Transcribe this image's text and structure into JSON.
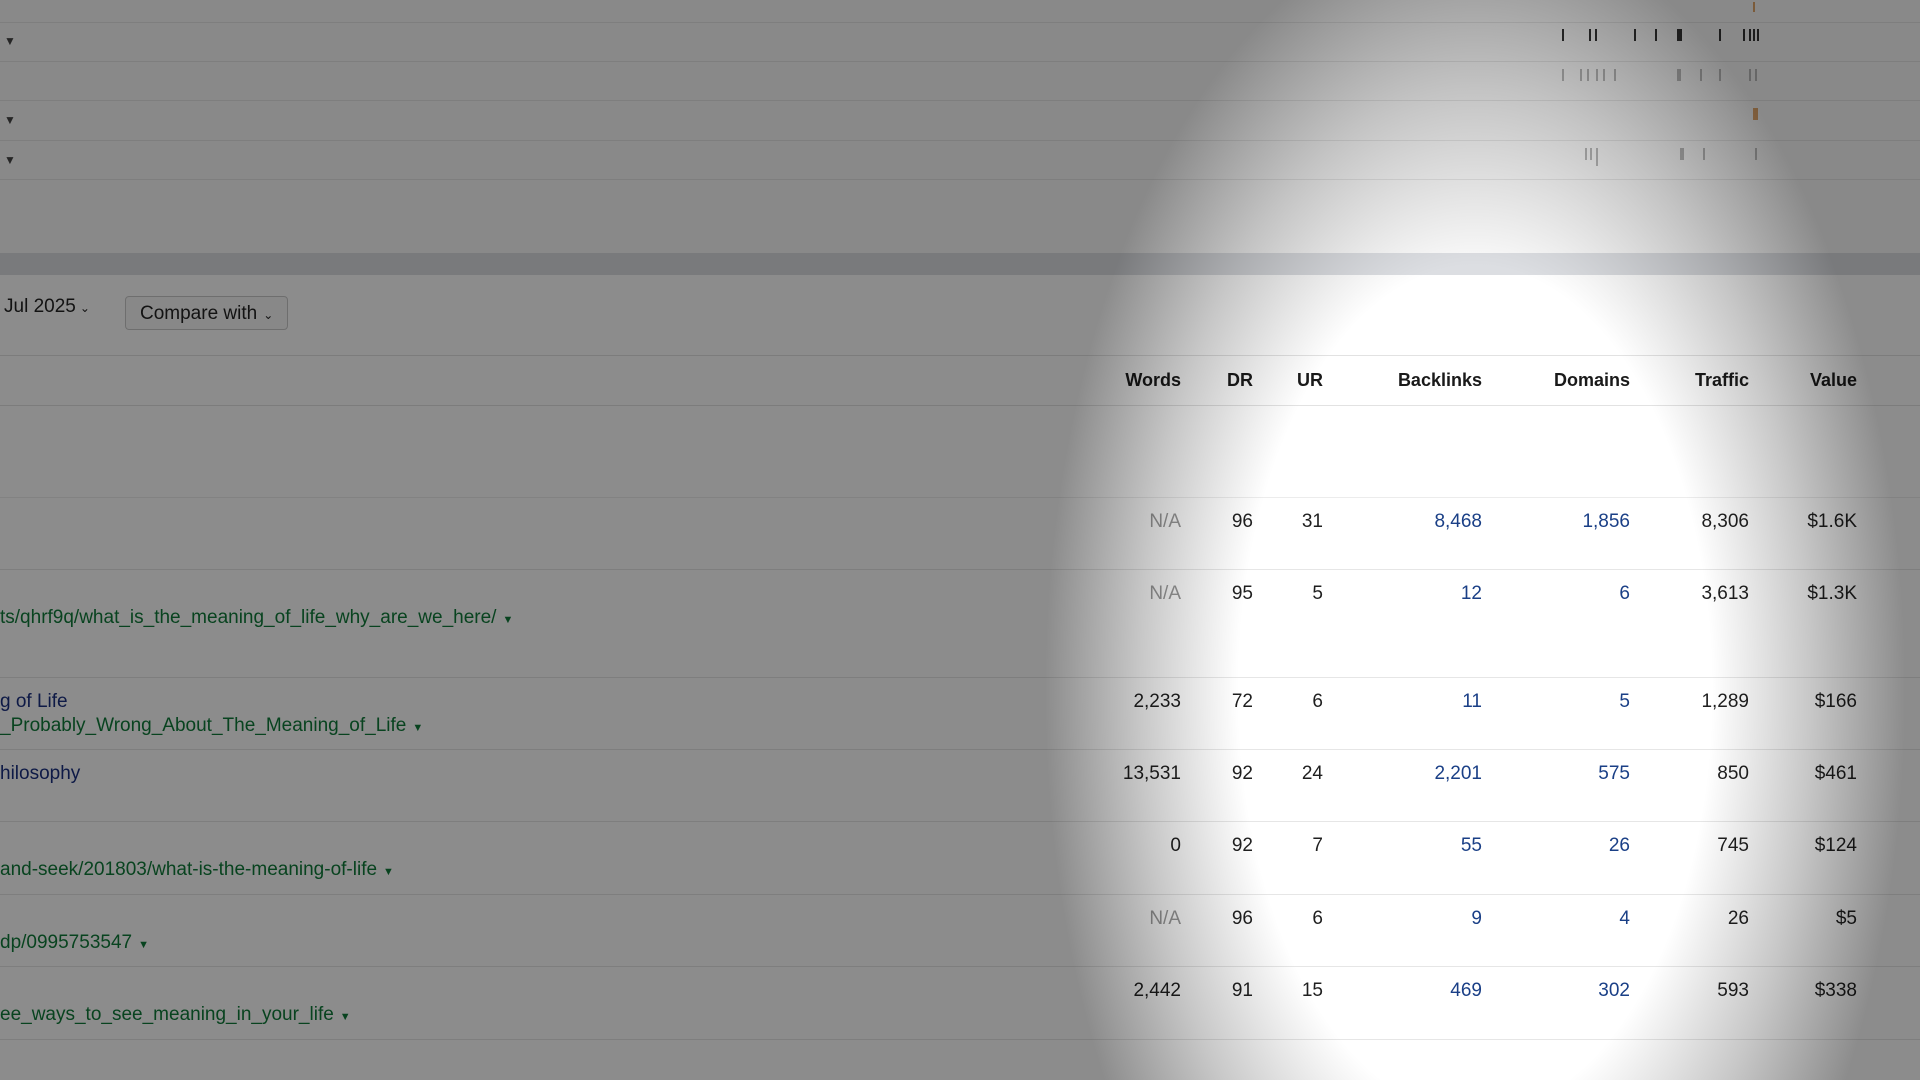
{
  "timeline": {
    "rows": [
      {
        "caret": "▼"
      },
      {
        "caret": ""
      },
      {
        "caret": "▼"
      },
      {
        "caret": "▼"
      }
    ]
  },
  "controls": {
    "date_label": "Jul 2025",
    "compare_label": "Compare with"
  },
  "table": {
    "headers": {
      "words": "Words",
      "dr": "DR",
      "ur": "UR",
      "backlinks": "Backlinks",
      "domains": "Domains",
      "traffic": "Traffic",
      "value": "Value"
    },
    "rows": [
      {
        "title": "",
        "url": "",
        "words": "N/A",
        "dr": "96",
        "ur": "31",
        "backlinks": "8,468",
        "domains": "1,856",
        "traffic": "8,306",
        "value": "$1.6K"
      },
      {
        "title": "",
        "url": "ts/qhrf9q/what_is_the_meaning_of_life_why_are_we_here/",
        "words": "N/A",
        "dr": "95",
        "ur": "5",
        "backlinks": "12",
        "domains": "6",
        "traffic": "3,613",
        "value": "$1.3K"
      },
      {
        "title": "g of Life",
        "url": "_Probably_Wrong_About_The_Meaning_of_Life",
        "words": "2,233",
        "dr": "72",
        "ur": "6",
        "backlinks": "11",
        "domains": "5",
        "traffic": "1,289",
        "value": "$166"
      },
      {
        "title": "hilosophy",
        "url": "",
        "words": "13,531",
        "dr": "92",
        "ur": "24",
        "backlinks": "2,201",
        "domains": "575",
        "traffic": "850",
        "value": "$461"
      },
      {
        "title": "",
        "url": "and-seek/201803/what-is-the-meaning-of-life",
        "words": "0",
        "dr": "92",
        "ur": "7",
        "backlinks": "55",
        "domains": "26",
        "traffic": "745",
        "value": "$124"
      },
      {
        "title": "",
        "url": "dp/0995753547",
        "words": "N/A",
        "dr": "96",
        "ur": "6",
        "backlinks": "9",
        "domains": "4",
        "traffic": "26",
        "value": "$5"
      },
      {
        "title": "",
        "url": "ee_ways_to_see_meaning_in_your_life",
        "words": "2,442",
        "dr": "91",
        "ur": "15",
        "backlinks": "469",
        "domains": "302",
        "traffic": "593",
        "value": "$338"
      }
    ]
  }
}
